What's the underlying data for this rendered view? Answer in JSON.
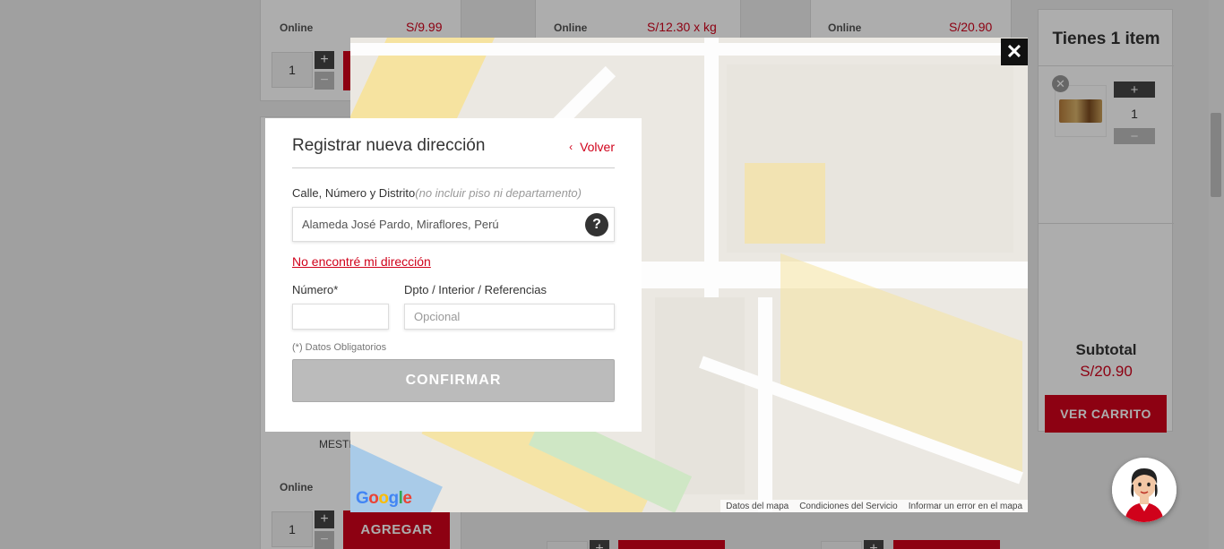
{
  "background": {
    "products": [
      {
        "online_label": "Online",
        "price": "S/9.99"
      },
      {
        "online_label": "Online",
        "price": "S/12.30 x kg"
      },
      {
        "online_label": "Online",
        "price": "S/20.90"
      }
    ],
    "bottom_product": {
      "brand_partial": "MESTI",
      "online_label": "Online",
      "qty": "1",
      "add_label": "AGREGAR"
    },
    "top_qty": "1",
    "plus_symbol": "+",
    "minus_symbol": "−"
  },
  "cart": {
    "title": "Tienes 1 item",
    "remove_symbol": "✕",
    "item_qty": "1",
    "subtotal_label": "Subtotal",
    "subtotal_value": "S/20.90",
    "view_cart_label": "VER CARRITO"
  },
  "map": {
    "close_symbol": "✕",
    "google_letters": [
      "G",
      "o",
      "o",
      "g",
      "l",
      "e"
    ],
    "footer_links": [
      "Datos del mapa",
      "Condiciones del Servicio",
      "Informar un error en el mapa"
    ]
  },
  "dialog": {
    "title": "Registrar nueva dirección",
    "back_label": "Volver",
    "back_chevron": "‹",
    "street_label": "Calle, Número y Distrito",
    "street_hint": "(no incluir piso ni departamento)",
    "street_value": "Alameda José Pardo, Miraflores, Perú",
    "help_symbol": "?",
    "not_found_link": "No encontré mi dirección",
    "number_label": "Número*",
    "number_value": "",
    "dpto_label": "Dpto / Interior / Referencias",
    "dpto_placeholder": "Opcional",
    "required_note": "(*) Datos Obligatorios",
    "confirm_label": "CONFIRMAR"
  }
}
